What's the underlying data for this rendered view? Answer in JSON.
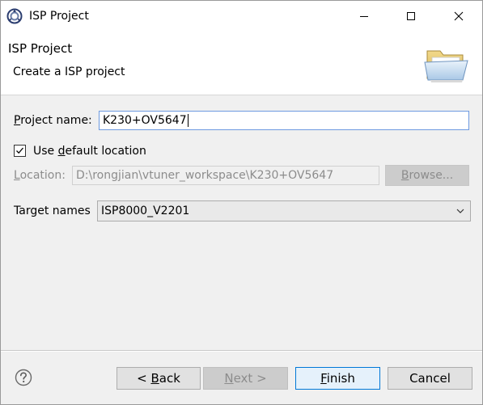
{
  "window": {
    "title": "ISP Project"
  },
  "banner": {
    "title": "ISP Project",
    "description": "Create a ISP project"
  },
  "form": {
    "project_name": {
      "label_first": "P",
      "label_rest": "roject name:",
      "value": "K230+OV5647"
    },
    "use_default_location": {
      "label_prefix": "Use ",
      "label_mnemonic": "d",
      "label_rest": "efault location",
      "checked": true
    },
    "location": {
      "label_first": "L",
      "label_rest": "ocation:",
      "value": "D:\\rongjian\\vtuner_workspace\\K230+OV5647",
      "browse_mnemonic": "B",
      "browse_rest": "rowse..."
    },
    "target": {
      "label": "Target names",
      "selected": "ISP8000_V2201"
    }
  },
  "buttons": {
    "back_prefix": "< ",
    "back_mnemonic": "B",
    "back_rest": "ack",
    "next_mnemonic": "N",
    "next_rest": "ext >",
    "finish_mnemonic": "F",
    "finish_rest": "inish",
    "cancel": "Cancel"
  },
  "icons": {
    "app": "eclipse-app-icon",
    "banner": "folder-icon",
    "help": "help-icon"
  },
  "colors": {
    "focus_border": "#0078d7",
    "input_border": "#6d9ae0",
    "disabled_text": "#8c8c8c",
    "dialog_bg": "#f0f0f0"
  }
}
